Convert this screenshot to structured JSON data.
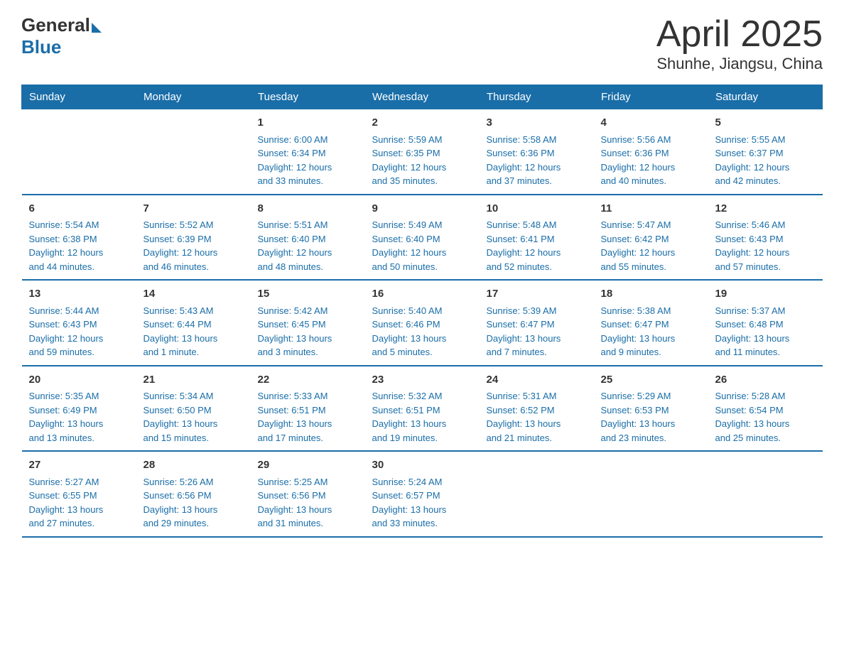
{
  "logo": {
    "general": "General",
    "blue": "Blue"
  },
  "title": "April 2025",
  "subtitle": "Shunhe, Jiangsu, China",
  "days_of_week": [
    "Sunday",
    "Monday",
    "Tuesday",
    "Wednesday",
    "Thursday",
    "Friday",
    "Saturday"
  ],
  "weeks": [
    [
      {
        "day": "",
        "info": ""
      },
      {
        "day": "",
        "info": ""
      },
      {
        "day": "1",
        "info": "Sunrise: 6:00 AM\nSunset: 6:34 PM\nDaylight: 12 hours\nand 33 minutes."
      },
      {
        "day": "2",
        "info": "Sunrise: 5:59 AM\nSunset: 6:35 PM\nDaylight: 12 hours\nand 35 minutes."
      },
      {
        "day": "3",
        "info": "Sunrise: 5:58 AM\nSunset: 6:36 PM\nDaylight: 12 hours\nand 37 minutes."
      },
      {
        "day": "4",
        "info": "Sunrise: 5:56 AM\nSunset: 6:36 PM\nDaylight: 12 hours\nand 40 minutes."
      },
      {
        "day": "5",
        "info": "Sunrise: 5:55 AM\nSunset: 6:37 PM\nDaylight: 12 hours\nand 42 minutes."
      }
    ],
    [
      {
        "day": "6",
        "info": "Sunrise: 5:54 AM\nSunset: 6:38 PM\nDaylight: 12 hours\nand 44 minutes."
      },
      {
        "day": "7",
        "info": "Sunrise: 5:52 AM\nSunset: 6:39 PM\nDaylight: 12 hours\nand 46 minutes."
      },
      {
        "day": "8",
        "info": "Sunrise: 5:51 AM\nSunset: 6:40 PM\nDaylight: 12 hours\nand 48 minutes."
      },
      {
        "day": "9",
        "info": "Sunrise: 5:49 AM\nSunset: 6:40 PM\nDaylight: 12 hours\nand 50 minutes."
      },
      {
        "day": "10",
        "info": "Sunrise: 5:48 AM\nSunset: 6:41 PM\nDaylight: 12 hours\nand 52 minutes."
      },
      {
        "day": "11",
        "info": "Sunrise: 5:47 AM\nSunset: 6:42 PM\nDaylight: 12 hours\nand 55 minutes."
      },
      {
        "day": "12",
        "info": "Sunrise: 5:46 AM\nSunset: 6:43 PM\nDaylight: 12 hours\nand 57 minutes."
      }
    ],
    [
      {
        "day": "13",
        "info": "Sunrise: 5:44 AM\nSunset: 6:43 PM\nDaylight: 12 hours\nand 59 minutes."
      },
      {
        "day": "14",
        "info": "Sunrise: 5:43 AM\nSunset: 6:44 PM\nDaylight: 13 hours\nand 1 minute."
      },
      {
        "day": "15",
        "info": "Sunrise: 5:42 AM\nSunset: 6:45 PM\nDaylight: 13 hours\nand 3 minutes."
      },
      {
        "day": "16",
        "info": "Sunrise: 5:40 AM\nSunset: 6:46 PM\nDaylight: 13 hours\nand 5 minutes."
      },
      {
        "day": "17",
        "info": "Sunrise: 5:39 AM\nSunset: 6:47 PM\nDaylight: 13 hours\nand 7 minutes."
      },
      {
        "day": "18",
        "info": "Sunrise: 5:38 AM\nSunset: 6:47 PM\nDaylight: 13 hours\nand 9 minutes."
      },
      {
        "day": "19",
        "info": "Sunrise: 5:37 AM\nSunset: 6:48 PM\nDaylight: 13 hours\nand 11 minutes."
      }
    ],
    [
      {
        "day": "20",
        "info": "Sunrise: 5:35 AM\nSunset: 6:49 PM\nDaylight: 13 hours\nand 13 minutes."
      },
      {
        "day": "21",
        "info": "Sunrise: 5:34 AM\nSunset: 6:50 PM\nDaylight: 13 hours\nand 15 minutes."
      },
      {
        "day": "22",
        "info": "Sunrise: 5:33 AM\nSunset: 6:51 PM\nDaylight: 13 hours\nand 17 minutes."
      },
      {
        "day": "23",
        "info": "Sunrise: 5:32 AM\nSunset: 6:51 PM\nDaylight: 13 hours\nand 19 minutes."
      },
      {
        "day": "24",
        "info": "Sunrise: 5:31 AM\nSunset: 6:52 PM\nDaylight: 13 hours\nand 21 minutes."
      },
      {
        "day": "25",
        "info": "Sunrise: 5:29 AM\nSunset: 6:53 PM\nDaylight: 13 hours\nand 23 minutes."
      },
      {
        "day": "26",
        "info": "Sunrise: 5:28 AM\nSunset: 6:54 PM\nDaylight: 13 hours\nand 25 minutes."
      }
    ],
    [
      {
        "day": "27",
        "info": "Sunrise: 5:27 AM\nSunset: 6:55 PM\nDaylight: 13 hours\nand 27 minutes."
      },
      {
        "day": "28",
        "info": "Sunrise: 5:26 AM\nSunset: 6:56 PM\nDaylight: 13 hours\nand 29 minutes."
      },
      {
        "day": "29",
        "info": "Sunrise: 5:25 AM\nSunset: 6:56 PM\nDaylight: 13 hours\nand 31 minutes."
      },
      {
        "day": "30",
        "info": "Sunrise: 5:24 AM\nSunset: 6:57 PM\nDaylight: 13 hours\nand 33 minutes."
      },
      {
        "day": "",
        "info": ""
      },
      {
        "day": "",
        "info": ""
      },
      {
        "day": "",
        "info": ""
      }
    ]
  ]
}
